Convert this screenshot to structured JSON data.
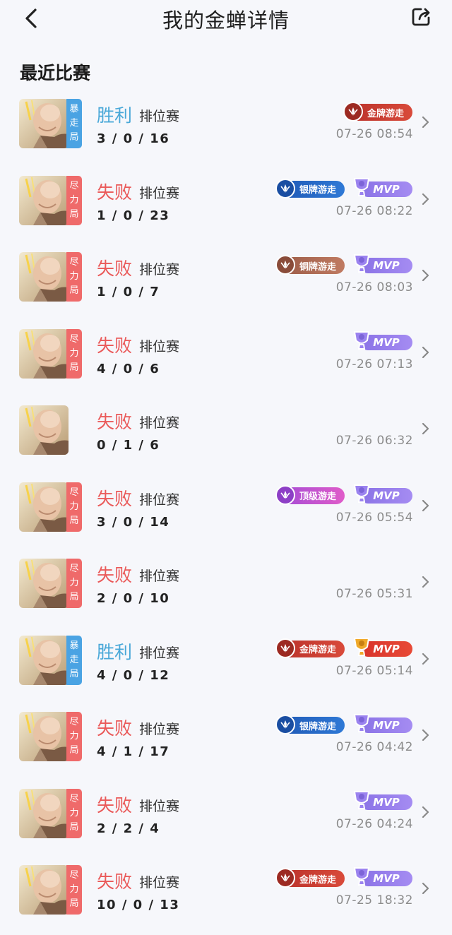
{
  "header": {
    "title": "我的金蝉详情"
  },
  "section": {
    "title": "最近比赛"
  },
  "matches": [
    {
      "result": "胜利",
      "outcome": "win",
      "type": "排位赛",
      "kda": "3/0/16",
      "time": "07-26 08:54",
      "mode": [
        "暴",
        "走",
        "局"
      ],
      "mode_color": "blue",
      "badge": "金牌游走",
      "badge_style": "gold",
      "mvp": ""
    },
    {
      "result": "失败",
      "outcome": "lose",
      "type": "排位赛",
      "kda": "1/0/23",
      "time": "07-26 08:22",
      "mode": [
        "尽",
        "力",
        "局"
      ],
      "mode_color": "red",
      "badge": "银牌游走",
      "badge_style": "silver",
      "mvp": "MVP",
      "mvp_style": "purple"
    },
    {
      "result": "失败",
      "outcome": "lose",
      "type": "排位赛",
      "kda": "1/0/7",
      "time": "07-26 08:03",
      "mode": [
        "尽",
        "力",
        "局"
      ],
      "mode_color": "red",
      "badge": "铜牌游走",
      "badge_style": "bronze",
      "mvp": "MVP",
      "mvp_style": "purple"
    },
    {
      "result": "失败",
      "outcome": "lose",
      "type": "排位赛",
      "kda": "4/0/6",
      "time": "07-26 07:13",
      "mode": [
        "尽",
        "力",
        "局"
      ],
      "mode_color": "red",
      "badge": "",
      "badge_style": "",
      "mvp": "MVP",
      "mvp_style": "purple"
    },
    {
      "result": "失败",
      "outcome": "lose",
      "type": "排位赛",
      "kda": "0/1/6",
      "time": "07-26 06:32",
      "mode": [],
      "mode_color": "none",
      "badge": "",
      "badge_style": "",
      "mvp": ""
    },
    {
      "result": "失败",
      "outcome": "lose",
      "type": "排位赛",
      "kda": "3/0/14",
      "time": "07-26 05:54",
      "mode": [
        "尽",
        "力",
        "局"
      ],
      "mode_color": "red",
      "badge": "顶级游走",
      "badge_style": "top",
      "mvp": "MVP",
      "mvp_style": "purple"
    },
    {
      "result": "失败",
      "outcome": "lose",
      "type": "排位赛",
      "kda": "2/0/10",
      "time": "07-26 05:31",
      "mode": [
        "尽",
        "力",
        "局"
      ],
      "mode_color": "red",
      "badge": "",
      "badge_style": "",
      "mvp": ""
    },
    {
      "result": "胜利",
      "outcome": "win",
      "type": "排位赛",
      "kda": "4/0/12",
      "time": "07-26 05:14",
      "mode": [
        "暴",
        "走",
        "局"
      ],
      "mode_color": "blue",
      "badge": "金牌游走",
      "badge_style": "gold",
      "mvp": "MVP",
      "mvp_style": "gold"
    },
    {
      "result": "失败",
      "outcome": "lose",
      "type": "排位赛",
      "kda": "4/1/17",
      "time": "07-26 04:42",
      "mode": [
        "尽",
        "力",
        "局"
      ],
      "mode_color": "red",
      "badge": "银牌游走",
      "badge_style": "silver",
      "mvp": "MVP",
      "mvp_style": "purple"
    },
    {
      "result": "失败",
      "outcome": "lose",
      "type": "排位赛",
      "kda": "2/2/4",
      "time": "07-26 04:24",
      "mode": [
        "尽",
        "力",
        "局"
      ],
      "mode_color": "red",
      "badge": "",
      "badge_style": "",
      "mvp": "MVP",
      "mvp_style": "purple"
    },
    {
      "result": "失败",
      "outcome": "lose",
      "type": "排位赛",
      "kda": "10/0/13",
      "time": "07-25 18:32",
      "mode": [
        "尽",
        "力",
        "局"
      ],
      "mode_color": "red",
      "badge": "金牌游走",
      "badge_style": "gold",
      "mvp": "MVP",
      "mvp_style": "purple"
    }
  ]
}
